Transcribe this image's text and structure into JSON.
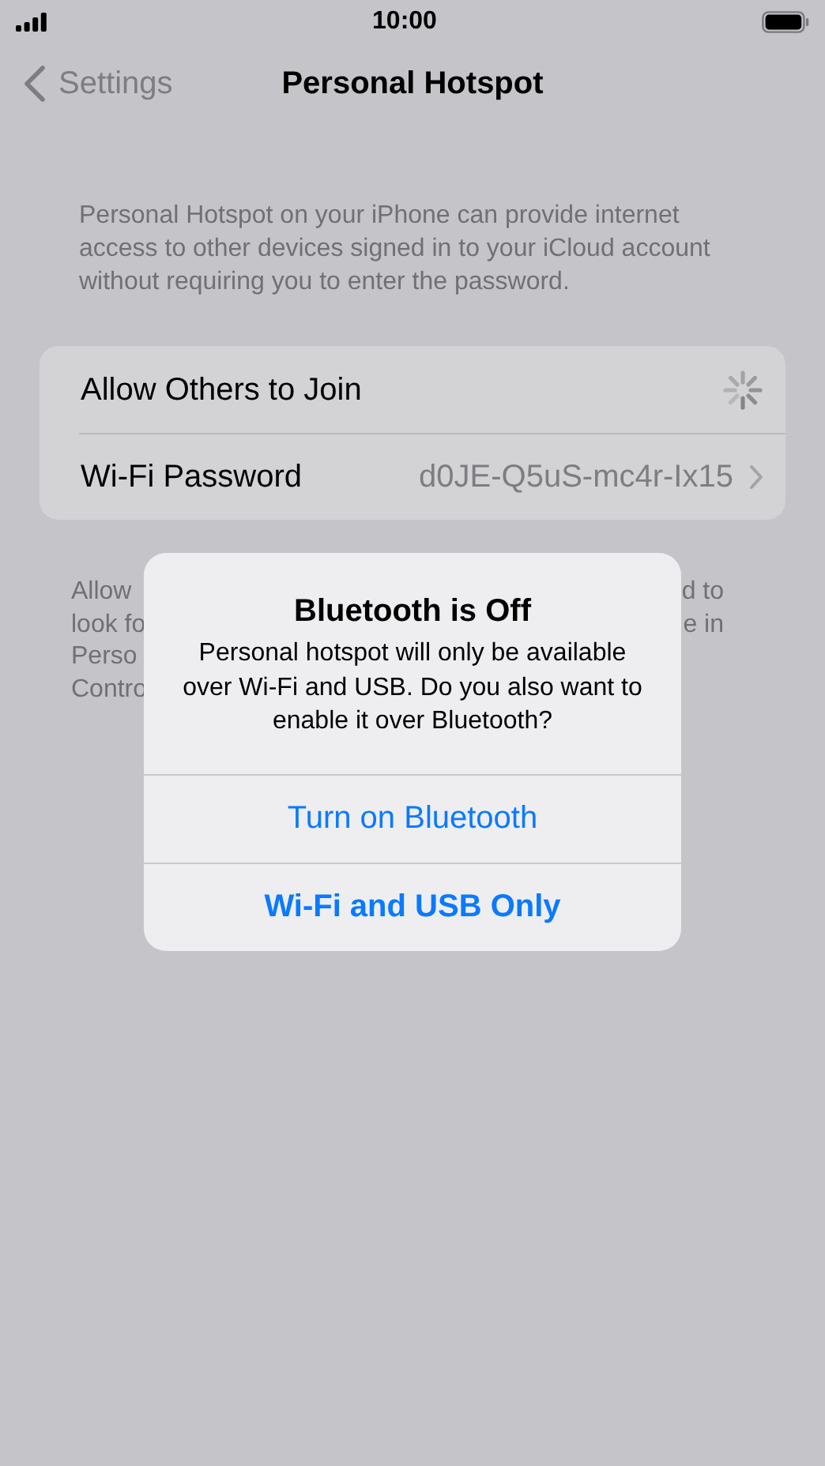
{
  "status_bar": {
    "time": "10:00"
  },
  "nav": {
    "back": "Settings",
    "title": "Personal Hotspot"
  },
  "description": "Personal Hotspot on your iPhone can provide internet access to other devices signed in to your iCloud account without requiring you to enter the password.",
  "rows": [
    {
      "kind": "spinner",
      "label": "Allow Others to Join"
    },
    {
      "kind": "disclosure",
      "label": "Wi-Fi Password",
      "value": "d0JE-Q5uS-mc4r-Ix15"
    }
  ],
  "footer": {
    "left_lines": [
      "Allow",
      "look fo",
      "Perso",
      "Contro"
    ],
    "right_lines": [
      "d to",
      "e in"
    ]
  },
  "alert": {
    "title": "Bluetooth is Off",
    "message": "Personal hotspot will only be available over Wi-Fi and USB. Do you also want to enable it over Bluetooth?",
    "buttons": [
      {
        "label": "Turn on Bluetooth",
        "preferred": false
      },
      {
        "label": "Wi-Fi and USB Only",
        "preferred": true
      }
    ]
  }
}
